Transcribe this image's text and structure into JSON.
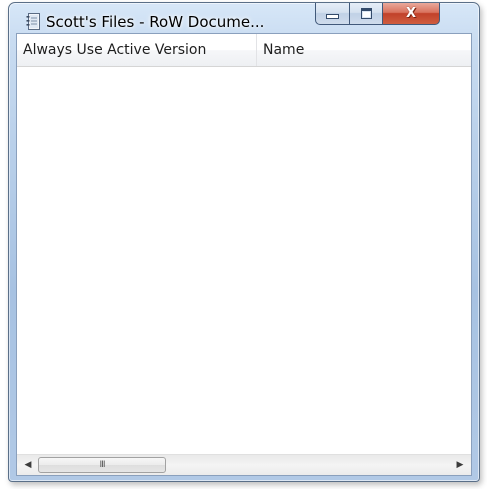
{
  "window": {
    "title": "Scott's Files - RoW Docume...",
    "app_icon": "notebook-icon",
    "caption_buttons": {
      "minimize_icon": "minimize-icon",
      "maximize_icon": "maximize-icon",
      "close_icon": "close-icon",
      "close_glyph": "X"
    }
  },
  "list": {
    "columns": [
      {
        "label": "Always Use Active Version"
      },
      {
        "label": "Name"
      }
    ],
    "rows": []
  },
  "hscroll": {
    "left_arrow": "◀",
    "right_arrow": "▶",
    "thumb_grip": "III"
  },
  "colors": {
    "frame": "#b9d0ea",
    "close_button": "#c1412a",
    "header_bg": "#f6f7f9"
  }
}
